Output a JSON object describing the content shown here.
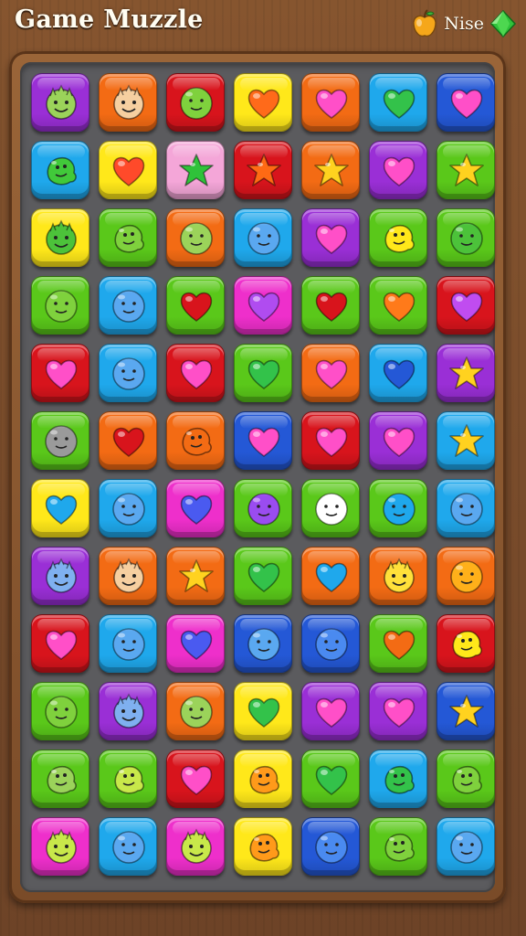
{
  "header": {
    "title": "Game Muzzle",
    "hud_label": "Nise",
    "fruit_icon": "apple-icon",
    "gem_icon": "green-gem-icon"
  },
  "colors": {
    "purple": "#9a2fd6",
    "orange": "#f36b14",
    "red": "#d8141c",
    "yellow": "#ffe81a",
    "blue": "#1fa8ec",
    "green": "#5ac81a",
    "pink": "#ee2fcb",
    "lightpink": "#f4a6d8",
    "darkblue": "#2458d6",
    "face_fill": "#9bd35a",
    "star_yellow": "#ffd21f"
  },
  "board": {
    "columns": 7,
    "rows": 12,
    "tiles": [
      [
        {
          "c": "purple",
          "i": "face-icon",
          "f": "#9bd35a"
        },
        {
          "c": "orange",
          "i": "face-icon",
          "f": "#f6cfa0"
        },
        {
          "c": "red",
          "i": "blob-icon",
          "f": "#7fd13d"
        },
        {
          "c": "yellow",
          "i": "heart-icon",
          "f": "#ff6a1a"
        },
        {
          "c": "orange",
          "i": "heart-icon",
          "f": "#ff4fc8"
        },
        {
          "c": "blue",
          "i": "heart-icon",
          "f": "#33c24a"
        },
        {
          "c": "darkblue",
          "i": "heart-icon",
          "f": "#ff4fc8"
        }
      ],
      [
        {
          "c": "blue",
          "i": "creature-icon",
          "f": "#41c93a"
        },
        {
          "c": "yellow",
          "i": "heart-icon",
          "f": "#ff4a2a"
        },
        {
          "c": "lightpink",
          "i": "star-icon",
          "f": "#2fc23a"
        },
        {
          "c": "red",
          "i": "star-icon",
          "f": "#ff6a14"
        },
        {
          "c": "orange",
          "i": "star-icon",
          "f": "#ffd21f"
        },
        {
          "c": "purple",
          "i": "heart-icon",
          "f": "#ff4fc8"
        },
        {
          "c": "green",
          "i": "star-icon",
          "f": "#ffd21f"
        }
      ],
      [
        {
          "c": "yellow",
          "i": "face-icon",
          "f": "#4cc23a"
        },
        {
          "c": "green",
          "i": "creature-icon",
          "f": "#7fd13d"
        },
        {
          "c": "orange",
          "i": "blob-icon",
          "f": "#9bd35a"
        },
        {
          "c": "blue",
          "i": "blob-icon",
          "f": "#5aa8f0"
        },
        {
          "c": "purple",
          "i": "heart-icon",
          "f": "#ff4fc8"
        },
        {
          "c": "green",
          "i": "creature-icon",
          "f": "#ffe81a"
        },
        {
          "c": "green",
          "i": "blob-icon",
          "f": "#4cc23a"
        }
      ],
      [
        {
          "c": "green",
          "i": "blob-icon",
          "f": "#7fd13d"
        },
        {
          "c": "blue",
          "i": "blob-icon",
          "f": "#5aa8f0"
        },
        {
          "c": "green",
          "i": "heart-icon",
          "f": "#d8141c"
        },
        {
          "c": "pink",
          "i": "heart-icon",
          "f": "#b04cf0"
        },
        {
          "c": "green",
          "i": "heart-icon",
          "f": "#d8141c"
        },
        {
          "c": "green",
          "i": "heart-icon",
          "f": "#ff7a1a"
        },
        {
          "c": "red",
          "i": "heart-icon",
          "f": "#c04cf0"
        }
      ],
      [
        {
          "c": "red",
          "i": "heart-icon",
          "f": "#ff4fc8"
        },
        {
          "c": "blue",
          "i": "blob-icon",
          "f": "#5aa8f0"
        },
        {
          "c": "red",
          "i": "heart-icon",
          "f": "#ff4fc8"
        },
        {
          "c": "green",
          "i": "heart-icon",
          "f": "#33c24a"
        },
        {
          "c": "orange",
          "i": "heart-icon",
          "f": "#ff4fc8"
        },
        {
          "c": "blue",
          "i": "heart-icon",
          "f": "#2458d6"
        },
        {
          "c": "purple",
          "i": "star-icon",
          "f": "#ffd21f"
        }
      ],
      [
        {
          "c": "green",
          "i": "blob-icon",
          "f": "#9a9a9a"
        },
        {
          "c": "orange",
          "i": "heart-icon",
          "f": "#d8141c"
        },
        {
          "c": "orange",
          "i": "creature-icon",
          "f": "#f36b14"
        },
        {
          "c": "darkblue",
          "i": "heart-icon",
          "f": "#ff4fc8"
        },
        {
          "c": "red",
          "i": "heart-icon",
          "f": "#ff4fc8"
        },
        {
          "c": "purple",
          "i": "heart-icon",
          "f": "#ff4fc8"
        },
        {
          "c": "blue",
          "i": "star-icon",
          "f": "#ffd21f"
        }
      ],
      [
        {
          "c": "yellow",
          "i": "heart-icon",
          "f": "#1fa8ec"
        },
        {
          "c": "blue",
          "i": "blob-icon",
          "f": "#5aa8f0"
        },
        {
          "c": "pink",
          "i": "heart-icon",
          "f": "#4a5af0"
        },
        {
          "c": "green",
          "i": "blob-icon",
          "f": "#9a4cf0"
        },
        {
          "c": "green",
          "i": "blob-icon",
          "f": "#ffffff"
        },
        {
          "c": "green",
          "i": "blob-icon",
          "f": "#1fa8ec"
        },
        {
          "c": "blue",
          "i": "blob-icon",
          "f": "#5aa8f0"
        }
      ],
      [
        {
          "c": "purple",
          "i": "face-icon",
          "f": "#7fb0f0"
        },
        {
          "c": "orange",
          "i": "face-icon",
          "f": "#f6cfa0"
        },
        {
          "c": "orange",
          "i": "star-icon",
          "f": "#ffd21f"
        },
        {
          "c": "green",
          "i": "heart-icon",
          "f": "#33c24a"
        },
        {
          "c": "orange",
          "i": "heart-icon",
          "f": "#1fa8ec"
        },
        {
          "c": "orange",
          "i": "face-icon",
          "f": "#ffe03a"
        },
        {
          "c": "orange",
          "i": "blob-icon",
          "f": "#ffb01a"
        }
      ],
      [
        {
          "c": "red",
          "i": "heart-icon",
          "f": "#ff4fc8"
        },
        {
          "c": "blue",
          "i": "blob-icon",
          "f": "#5aa8f0"
        },
        {
          "c": "pink",
          "i": "heart-icon",
          "f": "#4a5af0"
        },
        {
          "c": "darkblue",
          "i": "blob-icon",
          "f": "#5aa8f0"
        },
        {
          "c": "darkblue",
          "i": "blob-icon",
          "f": "#4a8af0"
        },
        {
          "c": "green",
          "i": "heart-icon",
          "f": "#f36b14"
        },
        {
          "c": "red",
          "i": "creature-icon",
          "f": "#ffe81a"
        }
      ],
      [
        {
          "c": "green",
          "i": "blob-icon",
          "f": "#7fd13d"
        },
        {
          "c": "purple",
          "i": "face-icon",
          "f": "#7fb0f0"
        },
        {
          "c": "orange",
          "i": "blob-icon",
          "f": "#9bd35a"
        },
        {
          "c": "yellow",
          "i": "heart-icon",
          "f": "#33c24a"
        },
        {
          "c": "purple",
          "i": "heart-icon",
          "f": "#ff4fc8"
        },
        {
          "c": "purple",
          "i": "heart-icon",
          "f": "#ff4fc8"
        },
        {
          "c": "darkblue",
          "i": "star-icon",
          "f": "#ffd21f"
        }
      ],
      [
        {
          "c": "green",
          "i": "creature-icon",
          "f": "#9bd35a"
        },
        {
          "c": "green",
          "i": "creature-icon",
          "f": "#c8e84a"
        },
        {
          "c": "red",
          "i": "heart-icon",
          "f": "#ff4fc8"
        },
        {
          "c": "yellow",
          "i": "creature-icon",
          "f": "#ff9a1a"
        },
        {
          "c": "green",
          "i": "heart-icon",
          "f": "#33c24a"
        },
        {
          "c": "blue",
          "i": "creature-icon",
          "f": "#33c24a"
        },
        {
          "c": "green",
          "i": "creature-icon",
          "f": "#7fd13d"
        }
      ],
      [
        {
          "c": "pink",
          "i": "face-icon",
          "f": "#c8e84a"
        },
        {
          "c": "blue",
          "i": "blob-icon",
          "f": "#5aa8f0"
        },
        {
          "c": "pink",
          "i": "face-icon",
          "f": "#c8e84a"
        },
        {
          "c": "yellow",
          "i": "creature-icon",
          "f": "#ff9a1a"
        },
        {
          "c": "darkblue",
          "i": "blob-icon",
          "f": "#4a8af0"
        },
        {
          "c": "green",
          "i": "creature-icon",
          "f": "#7fd13d"
        },
        {
          "c": "blue",
          "i": "blob-icon",
          "f": "#5aa8f0"
        }
      ]
    ]
  }
}
